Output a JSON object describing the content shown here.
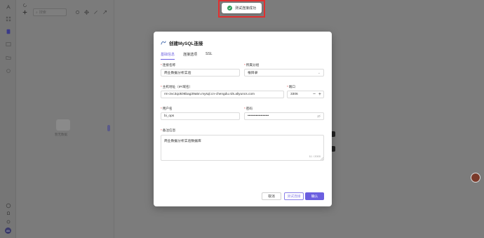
{
  "toast": {
    "message": "测试连接成功",
    "icon": "check-circle-icon"
  },
  "background": {
    "search_placeholder": "搜索",
    "empty_text": "暂无数据",
    "user_initials": "AA"
  },
  "modal": {
    "title": "创建MySQL连接",
    "tabs": [
      {
        "label": "基础信息",
        "active": true
      },
      {
        "label": "连接选项",
        "active": false
      },
      {
        "label": "SSL",
        "active": false
      }
    ],
    "fields": {
      "connection_name": {
        "label": "连接名称",
        "value": "商业数据分析实验"
      },
      "group": {
        "label": "所属分组",
        "value": "根目录"
      },
      "host": {
        "label": "主机地址（IP/域名）",
        "value": "rm-2vc3qok06bag39a5n.mysql.cn-chengdu.rds.aliyuncs.com"
      },
      "port": {
        "label": "端口",
        "value": "3306",
        "minus": "−",
        "plus": "+"
      },
      "username": {
        "label": "用户名",
        "value": "bi_ops"
      },
      "password": {
        "label": "密码",
        "value": "••••••••••••••••••"
      },
      "remark": {
        "label": "备注信息",
        "value": "商业数据分析实验数据库",
        "counter": "11 / 2000"
      }
    },
    "buttons": {
      "cancel": "取消",
      "test": "测试连接",
      "confirm": "确认"
    }
  },
  "colors": {
    "accent": "#6b5fe0",
    "success": "#2e9e5b",
    "highlight_frame": "#e03030"
  }
}
